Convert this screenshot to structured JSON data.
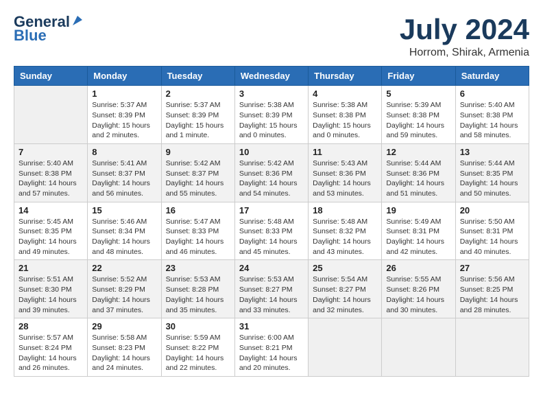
{
  "header": {
    "logo_line1": "General",
    "logo_line2": "Blue",
    "month_title": "July 2024",
    "location": "Horrom, Shirak, Armenia"
  },
  "days_of_week": [
    "Sunday",
    "Monday",
    "Tuesday",
    "Wednesday",
    "Thursday",
    "Friday",
    "Saturday"
  ],
  "weeks": [
    [
      {
        "day": "",
        "info": ""
      },
      {
        "day": "1",
        "info": "Sunrise: 5:37 AM\nSunset: 8:39 PM\nDaylight: 15 hours\nand 2 minutes."
      },
      {
        "day": "2",
        "info": "Sunrise: 5:37 AM\nSunset: 8:39 PM\nDaylight: 15 hours\nand 1 minute."
      },
      {
        "day": "3",
        "info": "Sunrise: 5:38 AM\nSunset: 8:39 PM\nDaylight: 15 hours\nand 0 minutes."
      },
      {
        "day": "4",
        "info": "Sunrise: 5:38 AM\nSunset: 8:38 PM\nDaylight: 15 hours\nand 0 minutes."
      },
      {
        "day": "5",
        "info": "Sunrise: 5:39 AM\nSunset: 8:38 PM\nDaylight: 14 hours\nand 59 minutes."
      },
      {
        "day": "6",
        "info": "Sunrise: 5:40 AM\nSunset: 8:38 PM\nDaylight: 14 hours\nand 58 minutes."
      }
    ],
    [
      {
        "day": "7",
        "info": "Sunrise: 5:40 AM\nSunset: 8:38 PM\nDaylight: 14 hours\nand 57 minutes."
      },
      {
        "day": "8",
        "info": "Sunrise: 5:41 AM\nSunset: 8:37 PM\nDaylight: 14 hours\nand 56 minutes."
      },
      {
        "day": "9",
        "info": "Sunrise: 5:42 AM\nSunset: 8:37 PM\nDaylight: 14 hours\nand 55 minutes."
      },
      {
        "day": "10",
        "info": "Sunrise: 5:42 AM\nSunset: 8:36 PM\nDaylight: 14 hours\nand 54 minutes."
      },
      {
        "day": "11",
        "info": "Sunrise: 5:43 AM\nSunset: 8:36 PM\nDaylight: 14 hours\nand 53 minutes."
      },
      {
        "day": "12",
        "info": "Sunrise: 5:44 AM\nSunset: 8:36 PM\nDaylight: 14 hours\nand 51 minutes."
      },
      {
        "day": "13",
        "info": "Sunrise: 5:44 AM\nSunset: 8:35 PM\nDaylight: 14 hours\nand 50 minutes."
      }
    ],
    [
      {
        "day": "14",
        "info": "Sunrise: 5:45 AM\nSunset: 8:35 PM\nDaylight: 14 hours\nand 49 minutes."
      },
      {
        "day": "15",
        "info": "Sunrise: 5:46 AM\nSunset: 8:34 PM\nDaylight: 14 hours\nand 48 minutes."
      },
      {
        "day": "16",
        "info": "Sunrise: 5:47 AM\nSunset: 8:33 PM\nDaylight: 14 hours\nand 46 minutes."
      },
      {
        "day": "17",
        "info": "Sunrise: 5:48 AM\nSunset: 8:33 PM\nDaylight: 14 hours\nand 45 minutes."
      },
      {
        "day": "18",
        "info": "Sunrise: 5:48 AM\nSunset: 8:32 PM\nDaylight: 14 hours\nand 43 minutes."
      },
      {
        "day": "19",
        "info": "Sunrise: 5:49 AM\nSunset: 8:31 PM\nDaylight: 14 hours\nand 42 minutes."
      },
      {
        "day": "20",
        "info": "Sunrise: 5:50 AM\nSunset: 8:31 PM\nDaylight: 14 hours\nand 40 minutes."
      }
    ],
    [
      {
        "day": "21",
        "info": "Sunrise: 5:51 AM\nSunset: 8:30 PM\nDaylight: 14 hours\nand 39 minutes."
      },
      {
        "day": "22",
        "info": "Sunrise: 5:52 AM\nSunset: 8:29 PM\nDaylight: 14 hours\nand 37 minutes."
      },
      {
        "day": "23",
        "info": "Sunrise: 5:53 AM\nSunset: 8:28 PM\nDaylight: 14 hours\nand 35 minutes."
      },
      {
        "day": "24",
        "info": "Sunrise: 5:53 AM\nSunset: 8:27 PM\nDaylight: 14 hours\nand 33 minutes."
      },
      {
        "day": "25",
        "info": "Sunrise: 5:54 AM\nSunset: 8:27 PM\nDaylight: 14 hours\nand 32 minutes."
      },
      {
        "day": "26",
        "info": "Sunrise: 5:55 AM\nSunset: 8:26 PM\nDaylight: 14 hours\nand 30 minutes."
      },
      {
        "day": "27",
        "info": "Sunrise: 5:56 AM\nSunset: 8:25 PM\nDaylight: 14 hours\nand 28 minutes."
      }
    ],
    [
      {
        "day": "28",
        "info": "Sunrise: 5:57 AM\nSunset: 8:24 PM\nDaylight: 14 hours\nand 26 minutes."
      },
      {
        "day": "29",
        "info": "Sunrise: 5:58 AM\nSunset: 8:23 PM\nDaylight: 14 hours\nand 24 minutes."
      },
      {
        "day": "30",
        "info": "Sunrise: 5:59 AM\nSunset: 8:22 PM\nDaylight: 14 hours\nand 22 minutes."
      },
      {
        "day": "31",
        "info": "Sunrise: 6:00 AM\nSunset: 8:21 PM\nDaylight: 14 hours\nand 20 minutes."
      },
      {
        "day": "",
        "info": ""
      },
      {
        "day": "",
        "info": ""
      },
      {
        "day": "",
        "info": ""
      }
    ]
  ]
}
